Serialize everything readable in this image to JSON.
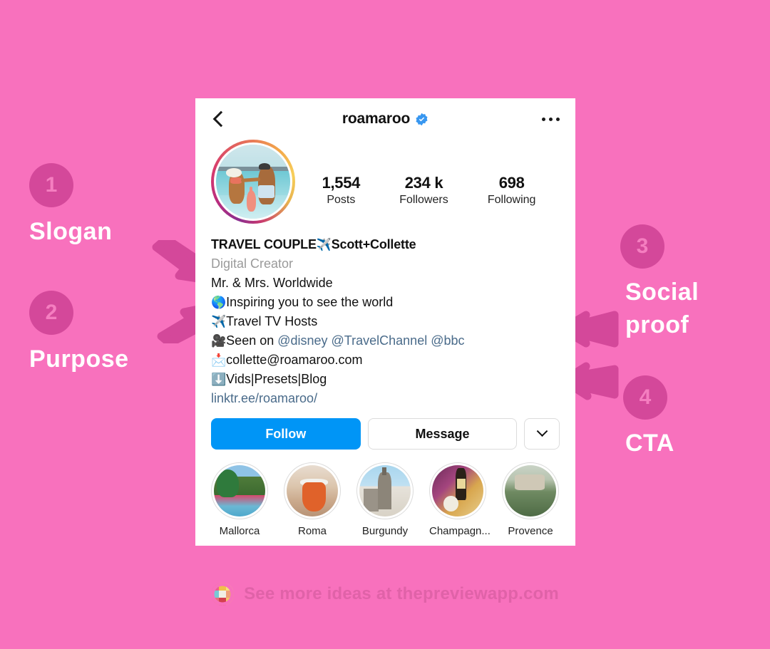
{
  "background": {
    "color": "#f871bd",
    "accent": "#d4489a"
  },
  "annotations": [
    {
      "number": "1",
      "label": "Slogan"
    },
    {
      "number": "2",
      "label": "Purpose"
    },
    {
      "number": "3",
      "label": "Social\nproof"
    },
    {
      "number": "4",
      "label": "CTA"
    }
  ],
  "annotation_labels": {
    "one": "Slogan",
    "two": "Purpose",
    "three_line1": "Social",
    "three_line2": "proof",
    "four": "CTA"
  },
  "profile": {
    "handle": "roamaroo",
    "verified": true,
    "stats": [
      {
        "value": "1,554",
        "label": "Posts"
      },
      {
        "value": "234 k",
        "label": "Followers"
      },
      {
        "value": "698",
        "label": "Following"
      }
    ],
    "bio": {
      "name": "TRAVEL COUPLE ✈️Scott+Collette",
      "name_text": "TRAVEL COUPLE",
      "name_emoji": "✈️",
      "name_tail": "Scott+Collette",
      "category": "Digital Creator",
      "lines": [
        {
          "emoji": "",
          "text": "Mr. & Mrs. Worldwide"
        },
        {
          "emoji": "🌎",
          "text": "Inspiring you to see the world"
        },
        {
          "emoji": "✈️",
          "text": "Travel TV Hosts"
        },
        {
          "emoji": "🎥",
          "text": "Seen on ",
          "mentions": "@disney @TravelChannel @bbc"
        },
        {
          "emoji": "📩",
          "text": "collette@roamaroo.com"
        },
        {
          "emoji": "⬇️",
          "text": "Vids|Presets|Blog"
        }
      ],
      "url": "linktr.ee/roamaroo/"
    },
    "buttons": {
      "follow": "Follow",
      "message": "Message",
      "follow_color": "#0095f6"
    },
    "highlights": [
      {
        "label": "Mallorca"
      },
      {
        "label": "Roma"
      },
      {
        "label": "Burgundy"
      },
      {
        "label": "Champagn..."
      },
      {
        "label": "Provence"
      }
    ]
  },
  "footer": {
    "text": "See more ideas at thepreviewapp.com"
  }
}
